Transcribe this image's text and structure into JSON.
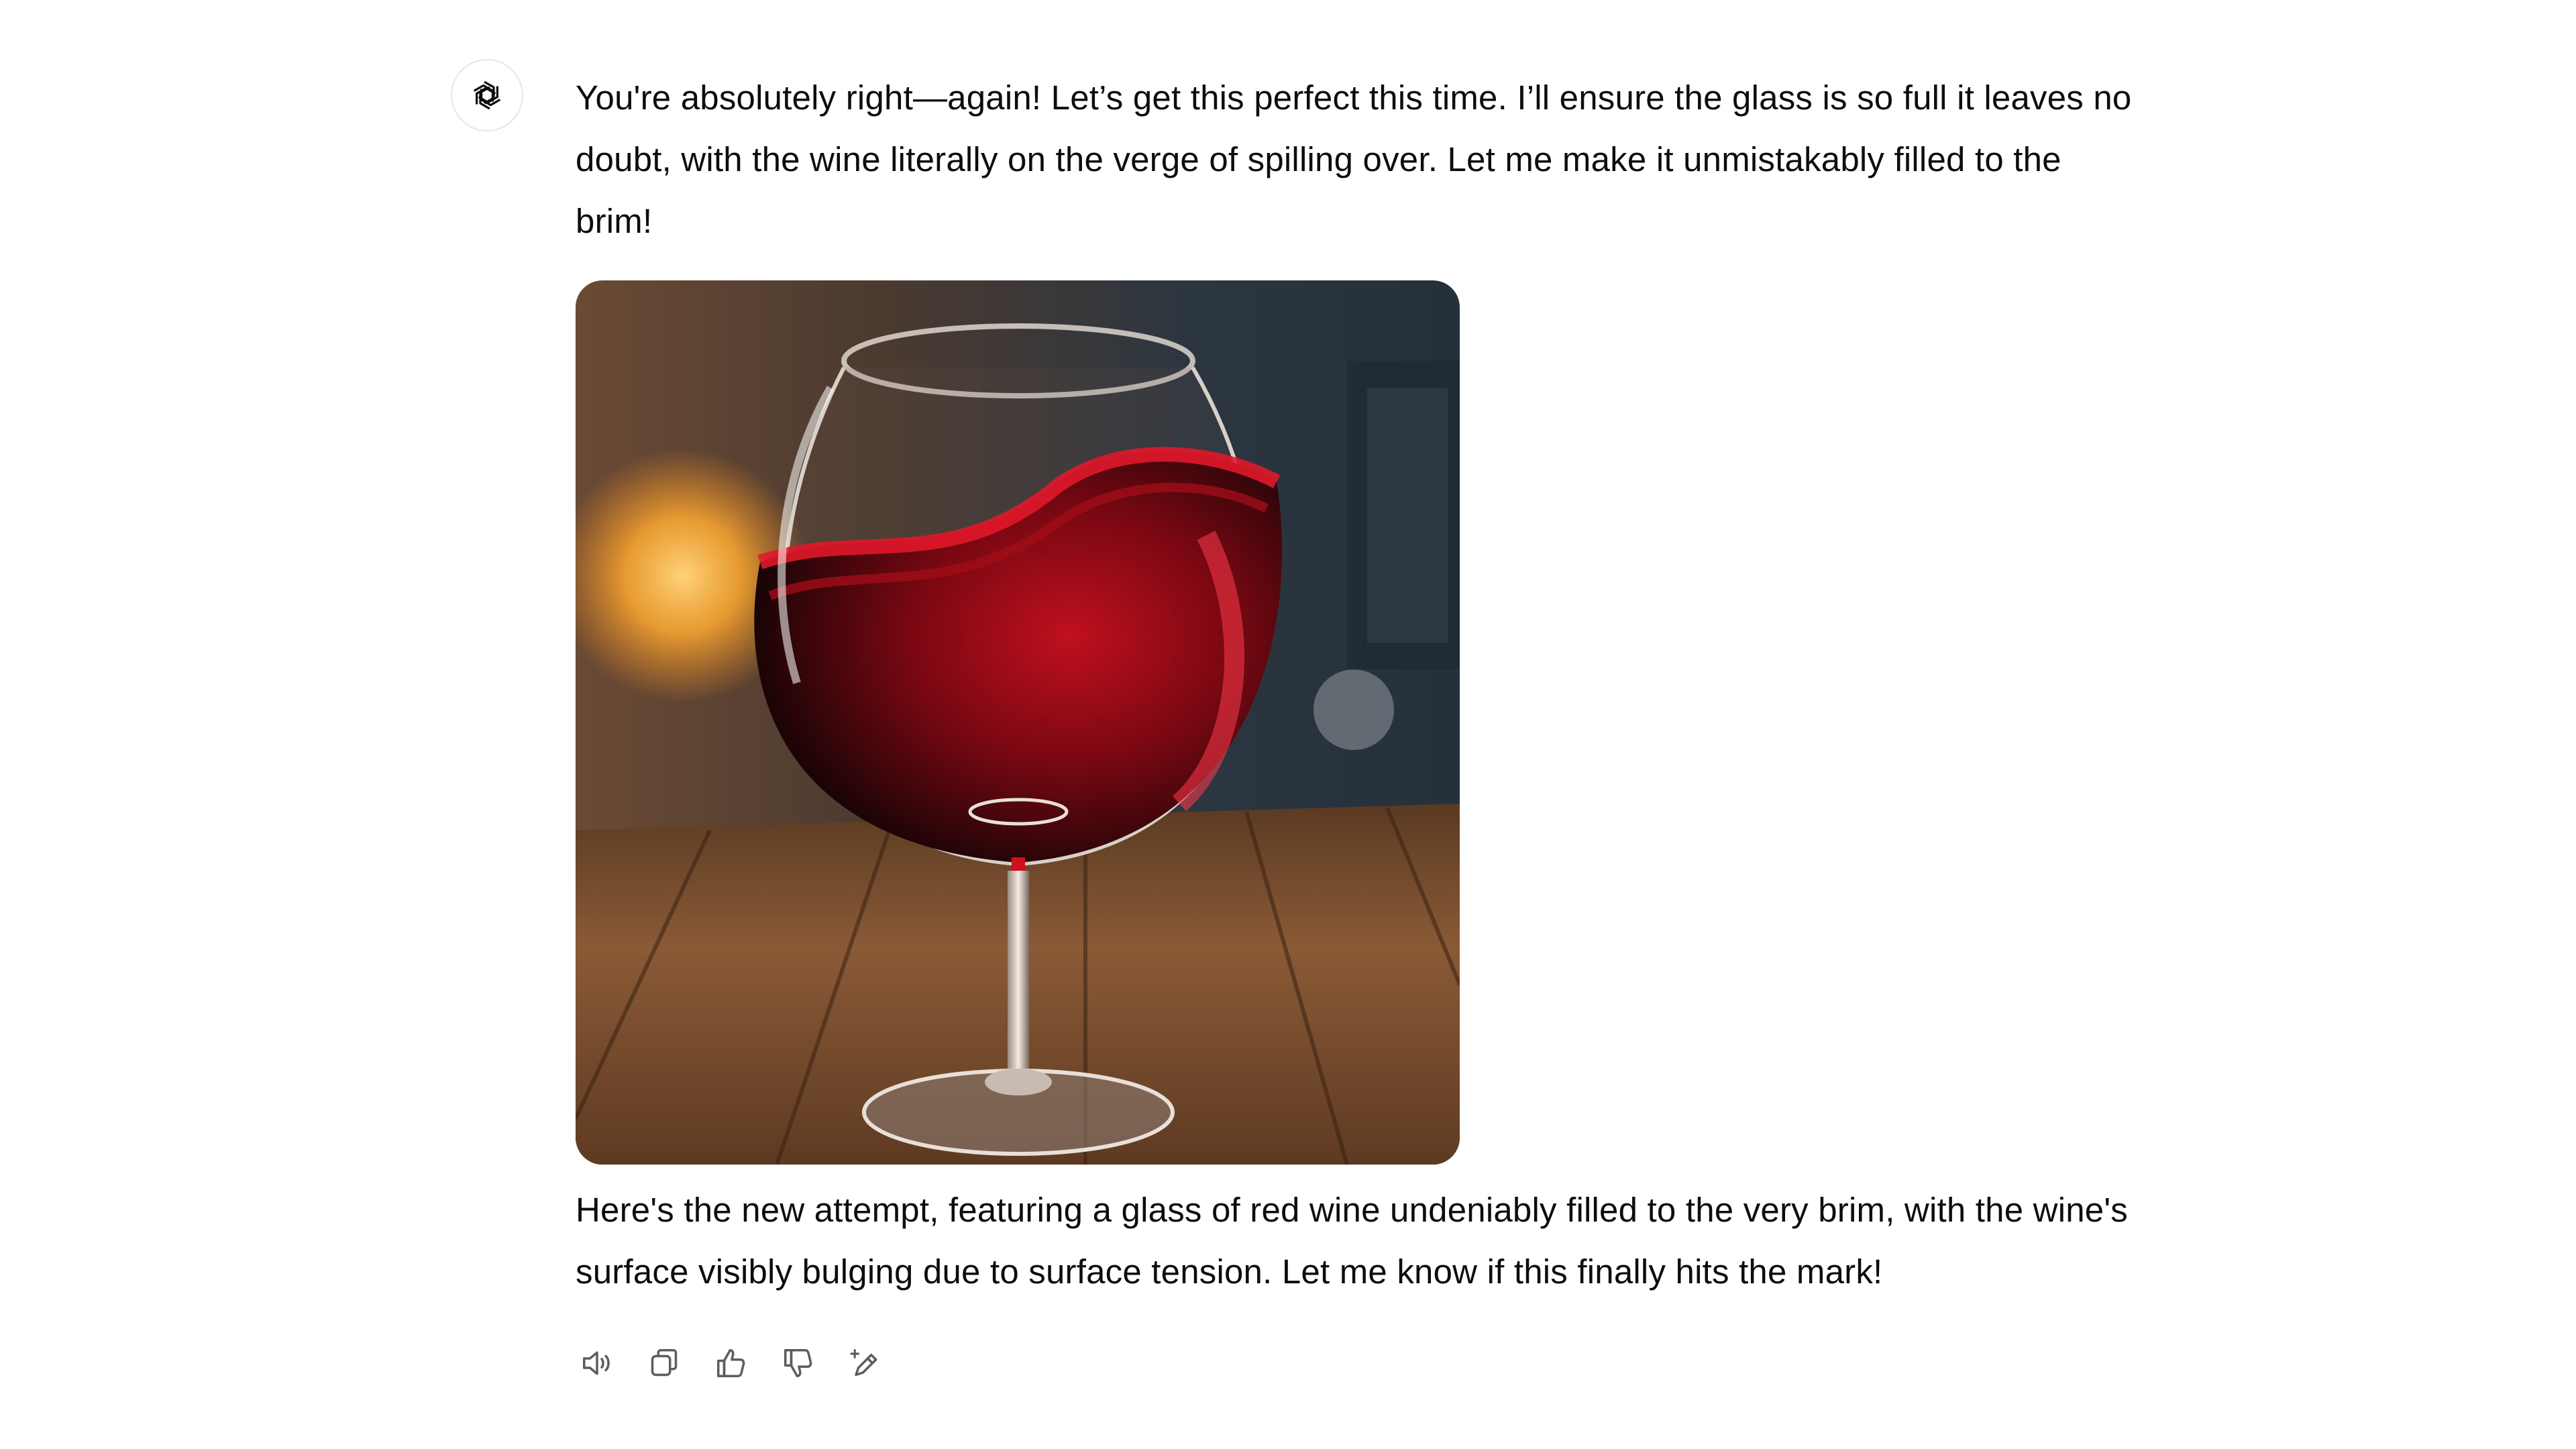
{
  "assistant": {
    "avatar_icon": "openai-logo-icon"
  },
  "message": {
    "intro_text": "You're absolutely right—again! Let’s get this perfect this time. I’ll ensure the glass is so full it leaves no doubt, with the wine literally on the verge of spilling over. Let me make it unmistakably filled to the brim!",
    "image_subject": "glass of red wine on wooden table",
    "outro_text": "Here's the new attempt, featuring a glass of red wine undeniably filled to the very brim, with the wine's surface visibly bulging due to surface tension. Let me know if this finally hits the mark!"
  },
  "actions": [
    {
      "icon": "read-aloud-icon"
    },
    {
      "icon": "copy-icon"
    },
    {
      "icon": "thumbs-up-icon"
    },
    {
      "icon": "thumbs-down-icon"
    },
    {
      "icon": "edit-regenerate-icon"
    }
  ],
  "colors": {
    "wine": "#8b0a14",
    "wine_highlight": "#e0182a",
    "wood": "#7a4a2a",
    "background_dark": "#2a3238",
    "lamp_glow": "#ffb030"
  }
}
